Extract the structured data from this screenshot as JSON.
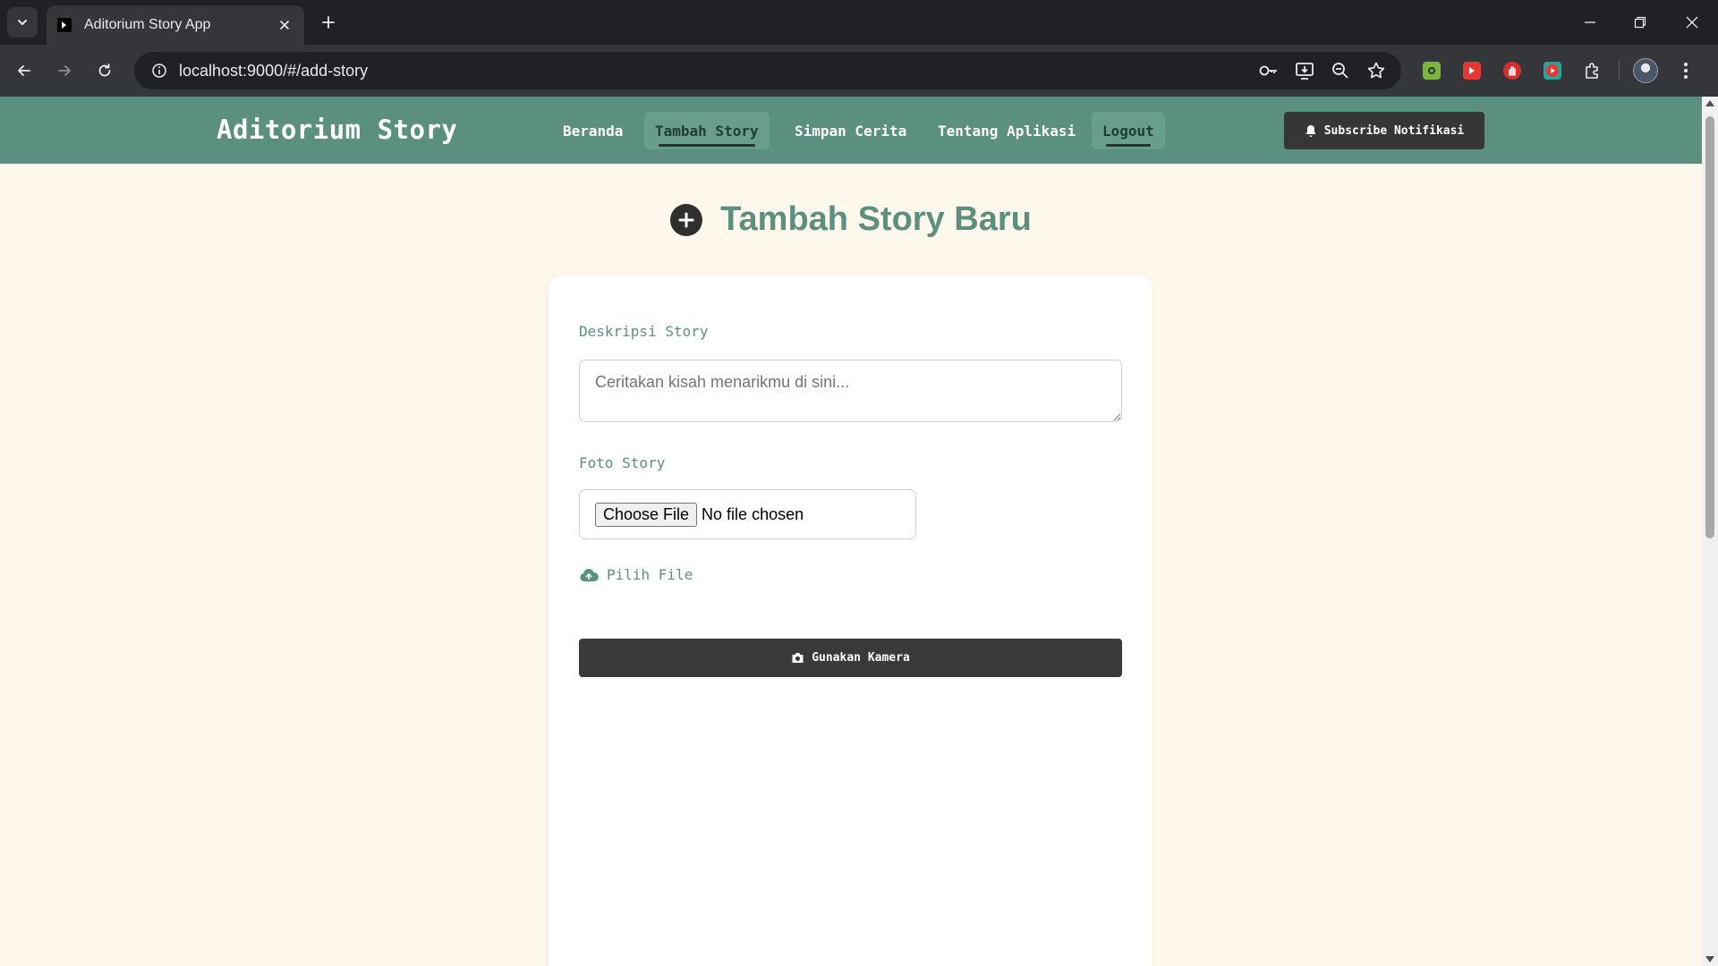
{
  "browser": {
    "tab_title": "Aditorium Story App",
    "url": "localhost:9000/#/add-story",
    "colors": {
      "frame": "#202124",
      "toolbar": "#35363a"
    },
    "omnibox_icons": [
      "password-key-icon",
      "install-app-icon",
      "zoom-icon",
      "bookmark-star-icon"
    ],
    "extensions": [
      "green-extension-icon",
      "red-play-extension-icon",
      "red-hand-extension-icon",
      "youtube-extension-icon",
      "puzzle-extensions-icon"
    ]
  },
  "app": {
    "brand": "Aditorium Story",
    "nav": [
      {
        "label": "Beranda",
        "active": false
      },
      {
        "label": "Tambah Story",
        "active": true
      },
      {
        "label": "Simpan Cerita",
        "active": false
      },
      {
        "label": "Tentang Aplikasi",
        "active": false
      },
      {
        "label": "Logout",
        "active": true
      }
    ],
    "subscribe_label": "Subscribe Notifikasi",
    "colors": {
      "primary": "#5b8f7f",
      "background": "#fff8ec",
      "dark_button": "#3a3a3a"
    }
  },
  "page": {
    "heading": "Tambah Story Baru",
    "form": {
      "description_label": "Deskripsi Story",
      "description_placeholder": "Ceritakan kisah menarikmu di sini...",
      "description_value": "",
      "photo_label": "Foto Story",
      "choose_file_label": "Choose File",
      "file_status": "No file chosen",
      "pick_file_label": "Pilih File",
      "camera_button_label": "Gunakan Kamera"
    }
  }
}
